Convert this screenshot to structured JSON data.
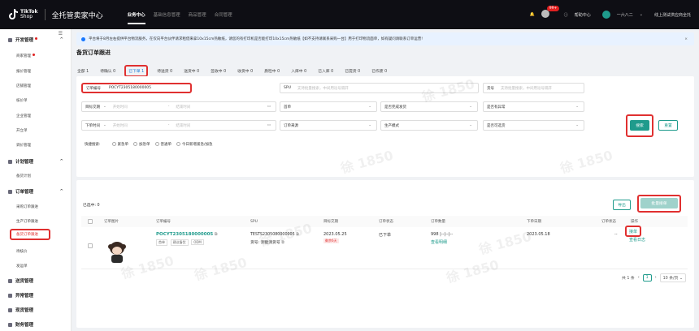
{
  "topbar": {
    "logo_line1": "TikTok",
    "logo_line2": "Shop",
    "app_name": "全托管卖家中心",
    "nav": [
      "业务中心",
      "基础信息管理",
      "商品管理",
      "合同管理"
    ],
    "notif_count": "99+",
    "help": "帮助中心",
    "account": "一六八二",
    "shop": "线上测试供应商全托"
  },
  "sidebar": {
    "groups": [
      {
        "label": "开发管理",
        "items": [
          "商家管理",
          "报价管理",
          "店铺管理",
          "核价单",
          "企业管理",
          "开立单",
          "调价管理"
        ]
      },
      {
        "label": "计划管理",
        "items": [
          "备货计划"
        ]
      },
      {
        "label": "订单管理",
        "items": [
          "采购订单跟进",
          "生产订单跟进",
          "备货订单跟进",
          "待核价",
          "发运单"
        ]
      },
      {
        "label": "送货管理",
        "items": []
      },
      {
        "label": "异常管理",
        "items": []
      },
      {
        "label": "现货管理",
        "items": []
      },
      {
        "label": "财务管理",
        "items": []
      }
    ]
  },
  "notice": "平台将于8月左右提供平台物流服务，在仅向平台伙伴请求租借来拿10x15cm热敏纸，请您的有打印机是否能打印10x15cm热敏纸【如不支持请联系采购一台】用于打印物流面单，如有疑问请联系订单运营!",
  "page_title": "备货订单跟进",
  "tabs": [
    {
      "label": "全部",
      "count": "1"
    },
    {
      "label": "待确认",
      "count": "0"
    },
    {
      "label": "已下单",
      "count": "1"
    },
    {
      "label": "待送货",
      "count": "0"
    },
    {
      "label": "送货中",
      "count": "0"
    },
    {
      "label": "签收中",
      "count": "0"
    },
    {
      "label": "收货中",
      "count": "0"
    },
    {
      "label": "质检中",
      "count": "0"
    },
    {
      "label": "入库中",
      "count": "0"
    },
    {
      "label": "已入库",
      "count": "0"
    },
    {
      "label": "已提货",
      "count": "0"
    },
    {
      "label": "已作废",
      "count": "0"
    }
  ],
  "filters": {
    "order_no_label": "订单编号",
    "order_no_value": "POCYT2305180000005",
    "spu_label": "SPU",
    "spu_placeholder": "支持批量搜索，中间用逗号隔开",
    "sku_label": "货号",
    "sku_placeholder": "支持批量搜索，中间用逗号隔开",
    "date1_select": "目标交期",
    "start_placeholder": "开始时间",
    "end_placeholder": "结束时间",
    "first_order": "首单",
    "is_sendable": "是否完成发货",
    "has_exception": "是否有异常",
    "date2_select": "下单时间",
    "order_source": "订单来源",
    "production_mode": "生产模式",
    "is_urgent": "是否可选货",
    "search_btn": "搜索",
    "reset_btn": "重置",
    "quick_label": "快捷搜索:",
    "quick_options": [
      "紧急单",
      "加急单",
      "普通单",
      "今日新增紧急/加急"
    ]
  },
  "list": {
    "selected": "已选中: 0",
    "export_btn": "导出",
    "batch_btn": "批量接单",
    "headers": [
      "订单图片",
      "订单编号",
      "SPU",
      "目标交期",
      "订单状态",
      "订单数量",
      "下单日期",
      "订单状态",
      "操作"
    ],
    "rows": [
      {
        "order_no": "POCYT2305180000005",
        "tag1": "首单",
        "tag2": "建议备货",
        "tag3": "ODM",
        "spu": "TESTS2305080000005",
        "sku": "货号: 测能测货号",
        "target_date": "2023.05.25",
        "remain": "剩余6天",
        "status": "已下单",
        "qty": "998 |--|--|--",
        "qty_link": "查看明细",
        "order_date": "2023.05.18",
        "dash": "--",
        "op1": "接单",
        "op2": "查看日志"
      }
    ],
    "pager": {
      "total": "共 1 条",
      "page": "1",
      "per_page": "10 条/页"
    }
  },
  "watermark": "徐 1850",
  "colors": {
    "accent": "#1f9b8c",
    "highlight": "#e03030",
    "link_blue": "#1a7ad6"
  }
}
